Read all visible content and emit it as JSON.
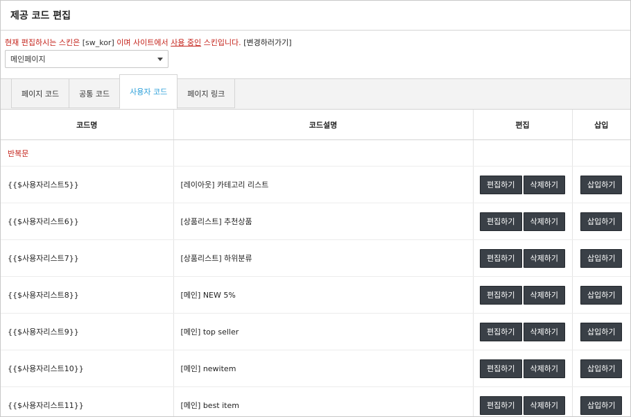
{
  "page": {
    "title": "제공 코드 편집"
  },
  "notice": {
    "part1": "현재 편집하시는 스킨은",
    "skin": "[sw_kor]",
    "part2": "이며 사이트에서",
    "inuse": "사용 중인",
    "part3": "스킨입니다.",
    "link": "[변경하러가기]"
  },
  "page_select": {
    "value": "메인페이지"
  },
  "tabs": [
    {
      "label": "페이지 코드",
      "active": false
    },
    {
      "label": "공통 코드",
      "active": false
    },
    {
      "label": "사용자 코드",
      "active": true
    },
    {
      "label": "페이지 링크",
      "active": false
    }
  ],
  "table": {
    "headers": {
      "code": "코드명",
      "desc": "코드설명",
      "edit": "편집",
      "insert": "삽입"
    },
    "group": "반복문",
    "buttons": {
      "edit": "편집하기",
      "delete": "삭제하기",
      "insert": "삽입하기"
    },
    "rows": [
      {
        "code": "{{$사용자리스트5}}",
        "desc": "[레이아웃] 카테고리 리스트"
      },
      {
        "code": "{{$사용자리스트6}}",
        "desc": "[상품리스트] 추천상품"
      },
      {
        "code": "{{$사용자리스트7}}",
        "desc": "[상품리스트] 하위분류"
      },
      {
        "code": "{{$사용자리스트8}}",
        "desc": "[메인] NEW 5%"
      },
      {
        "code": "{{$사용자리스트9}}",
        "desc": "[메인] top seller"
      },
      {
        "code": "{{$사용자리스트10}}",
        "desc": "[메인] newitem"
      },
      {
        "code": "{{$사용자리스트11}}",
        "desc": "[메인] best item"
      }
    ]
  },
  "colors": {
    "accent_tab": "#2b9fd9",
    "notice_red": "#c4221a",
    "button_bg": "#3a4047"
  }
}
